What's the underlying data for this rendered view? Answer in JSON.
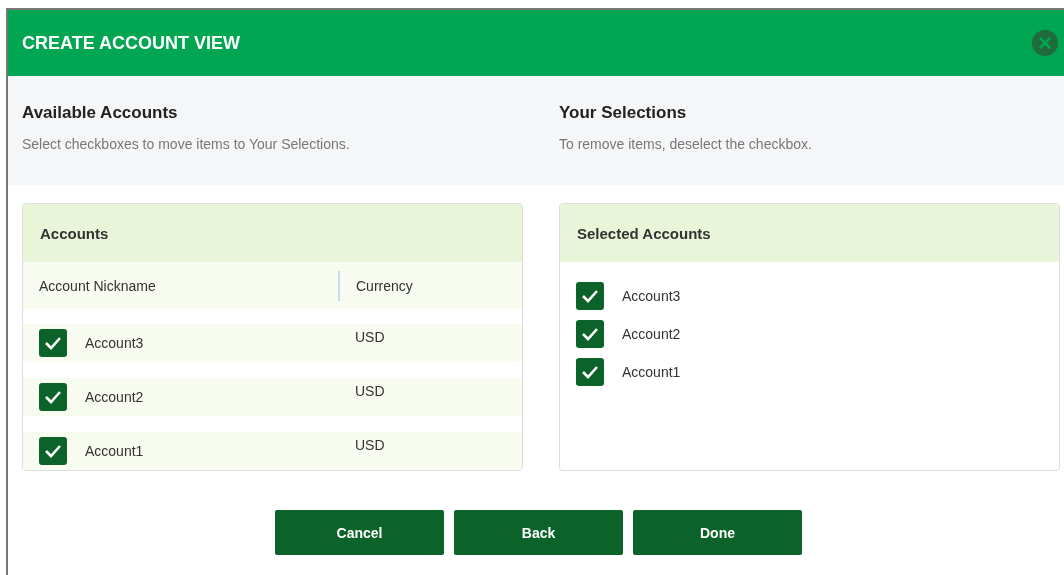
{
  "dialog": {
    "title": "CREATE ACCOUNT VIEW"
  },
  "available": {
    "heading": "Available Accounts",
    "hint": "Select checkboxes to move items to Your Selections."
  },
  "selections": {
    "heading": "Your Selections",
    "hint": "To remove items, deselect the checkbox."
  },
  "accounts_table": {
    "title": "Accounts",
    "columns": [
      "Account Nickname",
      "Currency"
    ],
    "rows": [
      {
        "nickname": "Account3",
        "currency": "USD",
        "checked": true
      },
      {
        "nickname": "Account2",
        "currency": "USD",
        "checked": true
      },
      {
        "nickname": "Account1",
        "currency": "USD",
        "checked": true
      }
    ]
  },
  "selected_accounts": {
    "title": "Selected Accounts",
    "items": [
      {
        "name": "Account3",
        "checked": true
      },
      {
        "name": "Account2",
        "checked": true
      },
      {
        "name": "Account1",
        "checked": true
      }
    ]
  },
  "buttons": [
    "Cancel",
    "Back",
    "Done"
  ]
}
